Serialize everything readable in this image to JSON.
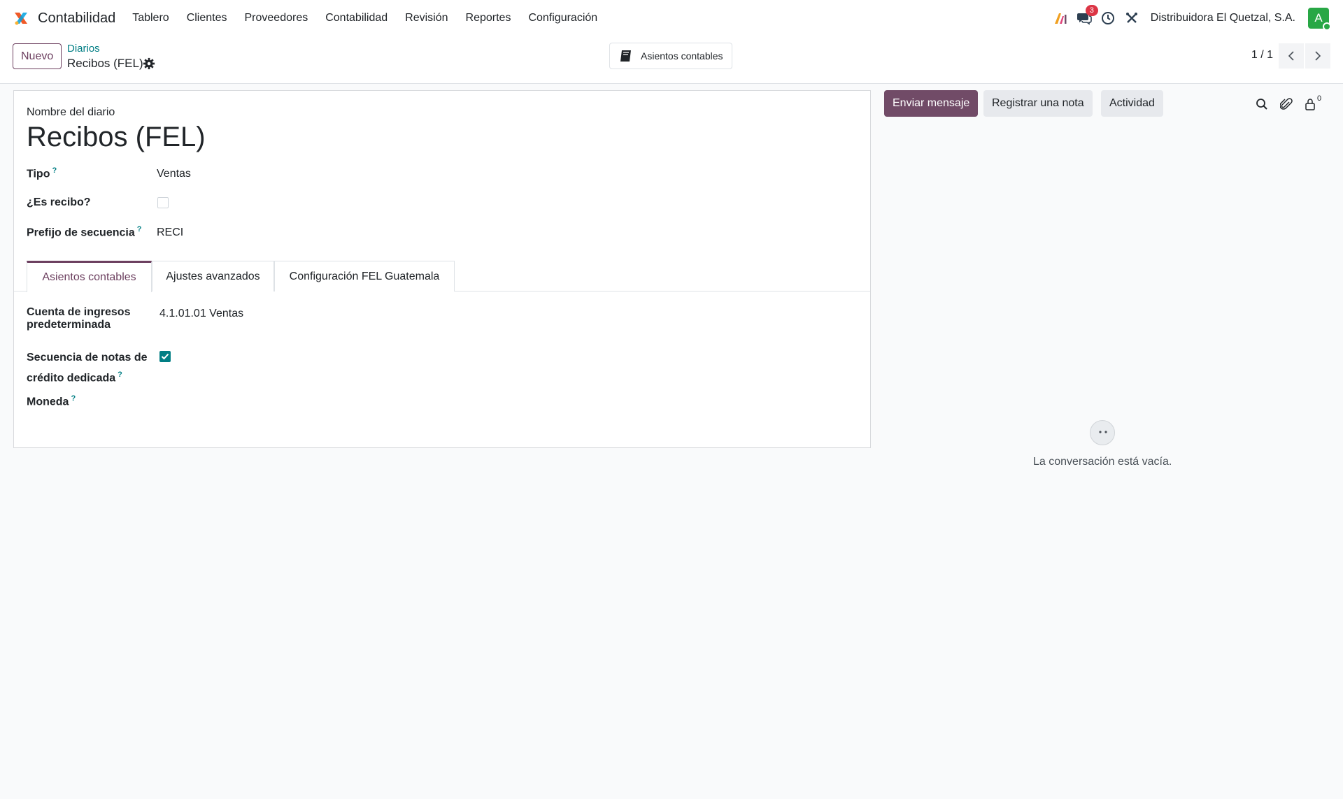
{
  "navbar": {
    "app_name": "Contabilidad",
    "menu": [
      "Tablero",
      "Clientes",
      "Proveedores",
      "Contabilidad",
      "Revisión",
      "Reportes",
      "Configuración"
    ],
    "messages_badge": "3",
    "company": "Distribuidora El Quetzal, S.A.",
    "avatar_letter": "A"
  },
  "control_panel": {
    "new_button": "Nuevo",
    "breadcrumb_parent": "Diarios",
    "breadcrumb_current": "Recibos (FEL)",
    "smart_button": "Asientos contables",
    "pager": "1 / 1"
  },
  "form": {
    "name_label": "Nombre del diario",
    "name_value": "Recibos (FEL)",
    "tipo_label": "Tipo",
    "tipo_value": "Ventas",
    "es_recibo_label": "¿Es recibo?",
    "es_recibo_checked": false,
    "prefijo_label": "Prefijo de secuencia",
    "prefijo_value": "RECI",
    "help_mark": "?",
    "tabs": [
      "Asientos contables",
      "Ajustes avanzados",
      "Configuración FEL Guatemala"
    ],
    "active_tab": "Asientos contables",
    "cuenta_label_1": "Cuenta de ingresos",
    "cuenta_label_2": "predeterminada",
    "cuenta_value": "4.1.01.01 Ventas",
    "secuencia_label_1": "Secuencia de notas de",
    "secuencia_label_2": "crédito dedicada",
    "secuencia_checked": true,
    "moneda_label": "Moneda"
  },
  "chatter": {
    "send_message": "Enviar mensaje",
    "log_note": "Registrar una nota",
    "activity": "Actividad",
    "followers_count": "0",
    "empty_text": "La conversación está vacía."
  },
  "colors": {
    "brand": "#714b67",
    "accent": "#017e84",
    "badge": "#dc3545",
    "avatar": "#28a745"
  }
}
